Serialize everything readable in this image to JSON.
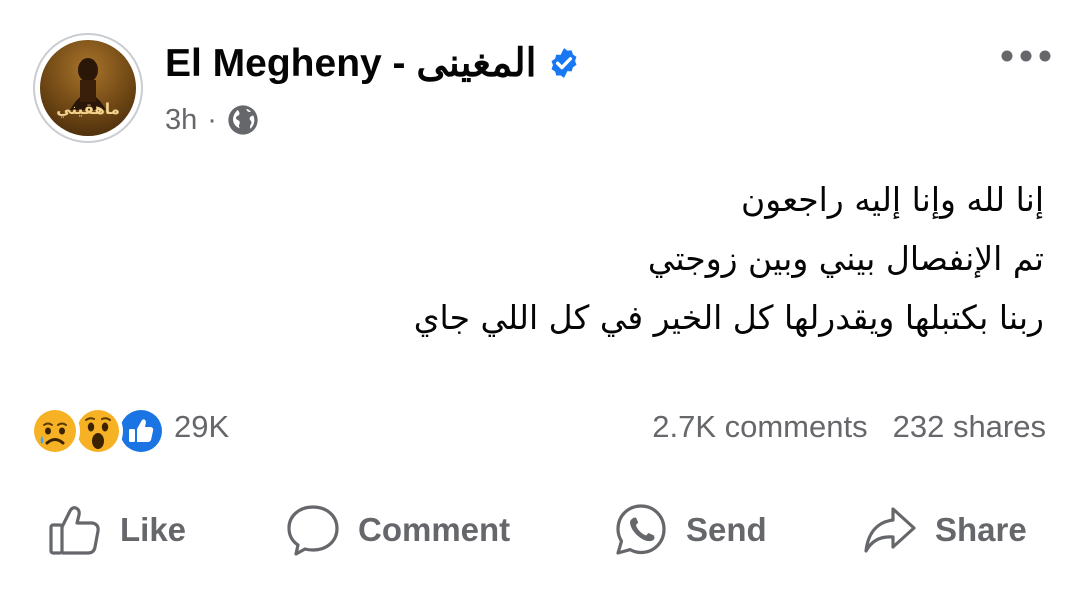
{
  "post": {
    "author": {
      "name": "El Megheny - المغينى",
      "avatar_poster_title": "ماهقيني",
      "verified": true
    },
    "time": "3h",
    "separator": "·",
    "audience_icon": "globe-icon",
    "more_icon": "more-options-icon",
    "text_lines": [
      "إنا لله وإنا إليه راجعون",
      "تم الإنفصال بيني وبين زوجتي",
      "ربنا بكتبلها ويقدرلها كل الخير في كل اللي جاي"
    ]
  },
  "reactions": {
    "types": [
      "sad-reaction-icon",
      "wow-reaction-icon",
      "like-reaction-icon"
    ],
    "count": "29K"
  },
  "stats": {
    "comments": "2.7K comments",
    "shares": "232 shares"
  },
  "actions": {
    "like": "Like",
    "comment": "Comment",
    "send": "Send",
    "share": "Share"
  },
  "colors": {
    "text_primary": "#050505",
    "text_secondary": "#65676b",
    "verified_blue": "#1877f2",
    "like_blue": "#1b74e4",
    "reaction_yellow": "#f7b125"
  }
}
